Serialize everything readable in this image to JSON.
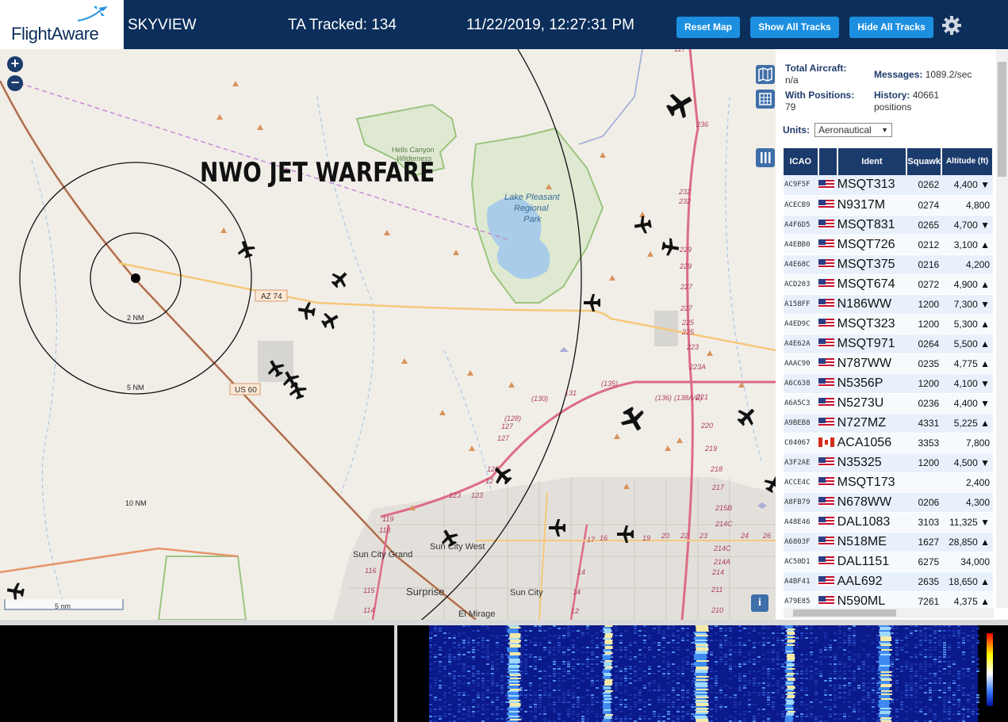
{
  "header": {
    "brand": "FlightAware",
    "site_name": "SKYVIEW",
    "tracked": "TA Tracked: 134",
    "clock": "11/22/2019, 12:27:31 PM",
    "buttons": {
      "reset": "Reset Map",
      "show_all": "Show All Tracks",
      "hide_all": "Hide All Tracks"
    },
    "settings_icon": "gear-icon"
  },
  "map": {
    "overlay_title": "NWO JET WARFARE",
    "range_rings": [
      "2 NM",
      "5 NM",
      "10 NM"
    ],
    "scale": "5 nm",
    "labels": {
      "az74": "AZ 74",
      "us60": "US 60",
      "lake": [
        "Lake Pleasant",
        "Regional",
        "Park"
      ],
      "hells_canyon": [
        "Hells Canyon",
        "Wilderness"
      ],
      "towns": [
        "Sun City Grand",
        "Sun City West",
        "Surprise",
        "Sun City",
        "El Mirage"
      ],
      "route_numbers": [
        "236",
        "232",
        "229",
        "227",
        "225",
        "223",
        "223A",
        "221",
        "220",
        "219",
        "218",
        "217",
        "215B",
        "214C",
        "214A",
        "211",
        "210",
        "(136)",
        "(138A/B)",
        "(135)",
        "131",
        "(130)",
        "(128)",
        "127",
        "125",
        "123",
        "119",
        "118",
        "116",
        "115",
        "114",
        "17",
        "16",
        "19",
        "20",
        "22",
        "23",
        "24",
        "26",
        "14",
        "12",
        "117"
      ]
    },
    "controls": {
      "zoom_in": "+",
      "zoom_out": "−",
      "info": "i"
    }
  },
  "stats": {
    "total_aircraft_label": "Total Aircraft:",
    "total_aircraft_value": "n/a",
    "messages_label": "Messages:",
    "messages_value": "1089.2/sec",
    "with_positions_label": "With Positions:",
    "with_positions_value": "79",
    "history_label": "History:",
    "history_value": "40661",
    "history_unit": "positions",
    "units_label": "Units:",
    "units_value": "Aeronautical"
  },
  "table": {
    "headers": [
      "ICAO",
      "",
      "Ident",
      "Squawk",
      "Altitude (ft)"
    ],
    "rows": [
      {
        "icao": "AC9F5F",
        "flag": "us",
        "ident": "MSQT313",
        "squawk": "0262",
        "alt": "4,400 ▼"
      },
      {
        "icao": "ACECB9",
        "flag": "us",
        "ident": "N9317M",
        "squawk": "0274",
        "alt": "4,800"
      },
      {
        "icao": "A4F6D5",
        "flag": "us",
        "ident": "MSQT831",
        "squawk": "0265",
        "alt": "4,700 ▼"
      },
      {
        "icao": "A4EBB0",
        "flag": "us",
        "ident": "MSQT726",
        "squawk": "0212",
        "alt": "3,100 ▲"
      },
      {
        "icao": "A4E68C",
        "flag": "us",
        "ident": "MSQT375",
        "squawk": "0216",
        "alt": "4,200"
      },
      {
        "icao": "ACD203",
        "flag": "us",
        "ident": "MSQT674",
        "squawk": "0272",
        "alt": "4,900 ▲"
      },
      {
        "icao": "A158FF",
        "flag": "us",
        "ident": "N186WW",
        "squawk": "1200",
        "alt": "7,300 ▼"
      },
      {
        "icao": "A4ED9C",
        "flag": "us",
        "ident": "MSQT323",
        "squawk": "1200",
        "alt": "5,300 ▲"
      },
      {
        "icao": "A4E62A",
        "flag": "us",
        "ident": "MSQT971",
        "squawk": "0264",
        "alt": "5,500 ▲"
      },
      {
        "icao": "AAAC90",
        "flag": "us",
        "ident": "N787WW",
        "squawk": "0235",
        "alt": "4,775 ▲"
      },
      {
        "icao": "A6C638",
        "flag": "us",
        "ident": "N5356P",
        "squawk": "1200",
        "alt": "4,100 ▼"
      },
      {
        "icao": "A6A5C3",
        "flag": "us",
        "ident": "N5273U",
        "squawk": "0236",
        "alt": "4,400 ▼"
      },
      {
        "icao": "A9BEB8",
        "flag": "us",
        "ident": "N727MZ",
        "squawk": "4331",
        "alt": "5,225 ▲"
      },
      {
        "icao": "C04067",
        "flag": "ca",
        "ident": "ACA1056",
        "squawk": "3353",
        "alt": "7,800"
      },
      {
        "icao": "A3F2AE",
        "flag": "us",
        "ident": "N35325",
        "squawk": "1200",
        "alt": "4,500 ▼"
      },
      {
        "icao": "ACCE4C",
        "flag": "us",
        "ident": "MSQT173",
        "squawk": "",
        "alt": "2,400"
      },
      {
        "icao": "A8FB79",
        "flag": "us",
        "ident": "N678WW",
        "squawk": "0206",
        "alt": "4,300"
      },
      {
        "icao": "A48E46",
        "flag": "us",
        "ident": "DAL1083",
        "squawk": "3103",
        "alt": "11,325 ▼"
      },
      {
        "icao": "A6803F",
        "flag": "us",
        "ident": "N518ME",
        "squawk": "1627",
        "alt": "28,850 ▲"
      },
      {
        "icao": "AC50D1",
        "flag": "us",
        "ident": "DAL1151",
        "squawk": "6275",
        "alt": "34,000"
      },
      {
        "icao": "A4BF41",
        "flag": "us",
        "ident": "AAL692",
        "squawk": "2635",
        "alt": "18,650 ▲"
      },
      {
        "icao": "A79E85",
        "flag": "us",
        "ident": "N590ML",
        "squawk": "7261",
        "alt": "4,375 ▲"
      }
    ]
  },
  "colors": {
    "header_bg": "#0b2e5a",
    "button_bg": "#1d8fe0",
    "table_header_bg": "#1b3b6c",
    "map_bg": "#f1eee8",
    "waterfall_base": "#0a1a8a"
  }
}
